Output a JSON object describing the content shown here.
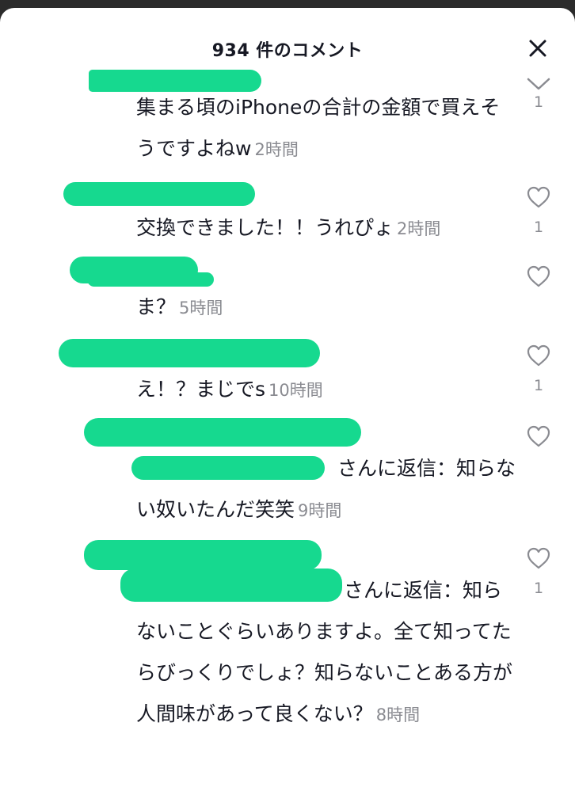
{
  "header": {
    "title": "934 件のコメント"
  },
  "comments": [
    {
      "text": "集まる頃のiPhoneの合計の金額で買えそうですよねw",
      "time": "2時間",
      "likes": "1"
    },
    {
      "text": "交換できました！！うれぴょ",
      "time": "2時間",
      "likes": "1"
    },
    {
      "text": "ま？",
      "time": "5時間",
      "likes": ""
    },
    {
      "text": "え！？まじでs",
      "time": "10時間",
      "likes": "1"
    },
    {
      "reply_prefix": "さんに返信：",
      "text": "知らない奴いたんだ笑笑",
      "time": "9時間",
      "likes": ""
    },
    {
      "reply_prefix": "さんに返信：",
      "text": "知らないことぐらいありますよ。全て知ってたらびっくりでしょ？知らないことある方が人間味があって良くない？",
      "time": "8時間",
      "likes": "1"
    }
  ],
  "colors": {
    "redaction": "#16d98f",
    "text": "#161823",
    "muted": "#8a8b91"
  },
  "icons": {
    "close": "close-icon",
    "like": "heart-outline-icon",
    "collapse": "chevron-down-icon"
  }
}
